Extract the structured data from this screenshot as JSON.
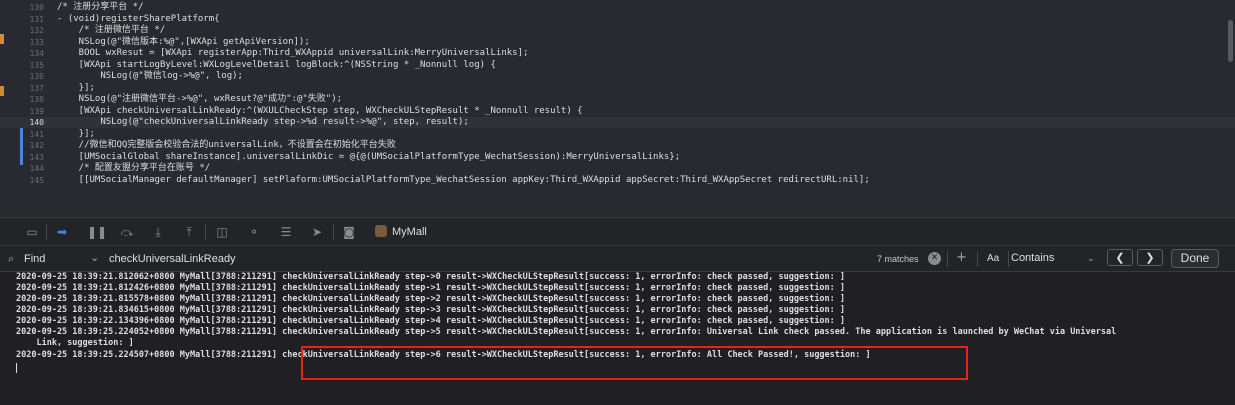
{
  "editor": {
    "lines": [
      {
        "num": "130",
        "text": "/* 注册分享平台 */"
      },
      {
        "num": "131",
        "text": "- (void)registerSharePlatform{"
      },
      {
        "num": "132",
        "text": "    /* 注册微信平台 */"
      },
      {
        "num": "133",
        "text": "    NSLog(@\"微信版本:%@\",[WXApi getApiVersion]);"
      },
      {
        "num": "134",
        "text": "    BOOL wxResut = [WXApi registerApp:Third_WXAppid universalLink:MerryUniversalLinks];"
      },
      {
        "num": "135",
        "text": "    [WXApi startLogByLevel:WXLogLevelDetail logBlock:^(NSString * _Nonnull log) {"
      },
      {
        "num": "136",
        "text": "        NSLog(@\"微信log->%@\", log);"
      },
      {
        "num": "137",
        "text": "    }];"
      },
      {
        "num": "138",
        "text": "    NSLog(@\"注册微信平台->%@\", wxResut?@\"成功\":@\"失败\");"
      },
      {
        "num": "139",
        "text": "    [WXApi checkUniversalLinkReady:^(WXULCheckStep step, WXCheckULStepResult * _Nonnull result) {"
      },
      {
        "num": "140",
        "text": "        NSLog(@\"checkUniversalLinkReady step->%d result->%@\", step, result);"
      },
      {
        "num": "141",
        "text": "    }];"
      },
      {
        "num": "142",
        "text": "    //微信和QQ完整版会校验合法的universalLink，不设置会在初始化平台失败"
      },
      {
        "num": "143",
        "text": "    [UMSocialGlobal shareInstance].universalLinkDic = @{@(UMSocialPlatformType_WechatSession):MerryUniversalLinks};"
      },
      {
        "num": "144",
        "text": "    /* 配置友盟分享平台在账号 */"
      },
      {
        "num": "145",
        "text": "    [[UMSocialManager defaultManager] setPlaform:UMSocialPlatformType_WechatSession appKey:Third_WXAppid appSecret:Third_WXAppSecret redirectURL:nil];"
      }
    ],
    "current_line": "140"
  },
  "debug_bar": {
    "icons": [
      "hide-debug-area-icon",
      "breakpoints-toggle-icon",
      "pause-icon",
      "step-over-icon",
      "step-into-icon",
      "step-out-icon",
      "view-hierarchy-icon",
      "memory-graph-icon",
      "environment-overrides-icon",
      "simulate-location-icon",
      "camera-icon"
    ],
    "app_name": "MyMall"
  },
  "find_bar": {
    "mode": "Find",
    "query": "checkUniversalLinkReady",
    "match_count": "7 matches",
    "case_label": "Aa",
    "match_type": "Contains",
    "done_label": "Done"
  },
  "console": {
    "lines": [
      "2020-09-25 18:39:21.812062+0800 MyMall[3788:211291] checkUniversalLinkReady step->0 result->WXCheckULStepResult[success: 1, errorInfo: check passed, suggestion: ]",
      "2020-09-25 18:39:21.812426+0800 MyMall[3788:211291] checkUniversalLinkReady step->1 result->WXCheckULStepResult[success: 1, errorInfo: check passed, suggestion: ]",
      "2020-09-25 18:39:21.815578+0800 MyMall[3788:211291] checkUniversalLinkReady step->2 result->WXCheckULStepResult[success: 1, errorInfo: check passed, suggestion: ]",
      "2020-09-25 18:39:21.834615+0800 MyMall[3788:211291] checkUniversalLinkReady step->3 result->WXCheckULStepResult[success: 1, errorInfo: check passed, suggestion: ]",
      "2020-09-25 18:39:22.134396+0800 MyMall[3788:211291] checkUniversalLinkReady step->4 result->WXCheckULStepResult[success: 1, errorInfo: check passed, suggestion: ]",
      "2020-09-25 18:39:25.224052+0800 MyMall[3788:211291] checkUniversalLinkReady step->5 result->WXCheckULStepResult[success: 1, errorInfo: Universal Link check passed. The application is launched by WeChat via Universal",
      "    Link, suggestion: ]",
      "2020-09-25 18:39:25.224507+0800 MyMall[3788:211291] checkUniversalLinkReady step->6 result->WXCheckULStepResult[success: 1, errorInfo: All Check Passed!, suggestion: ]"
    ]
  },
  "colors": {
    "accent": "#3d88f5",
    "highlight_border": "#e6221b"
  }
}
